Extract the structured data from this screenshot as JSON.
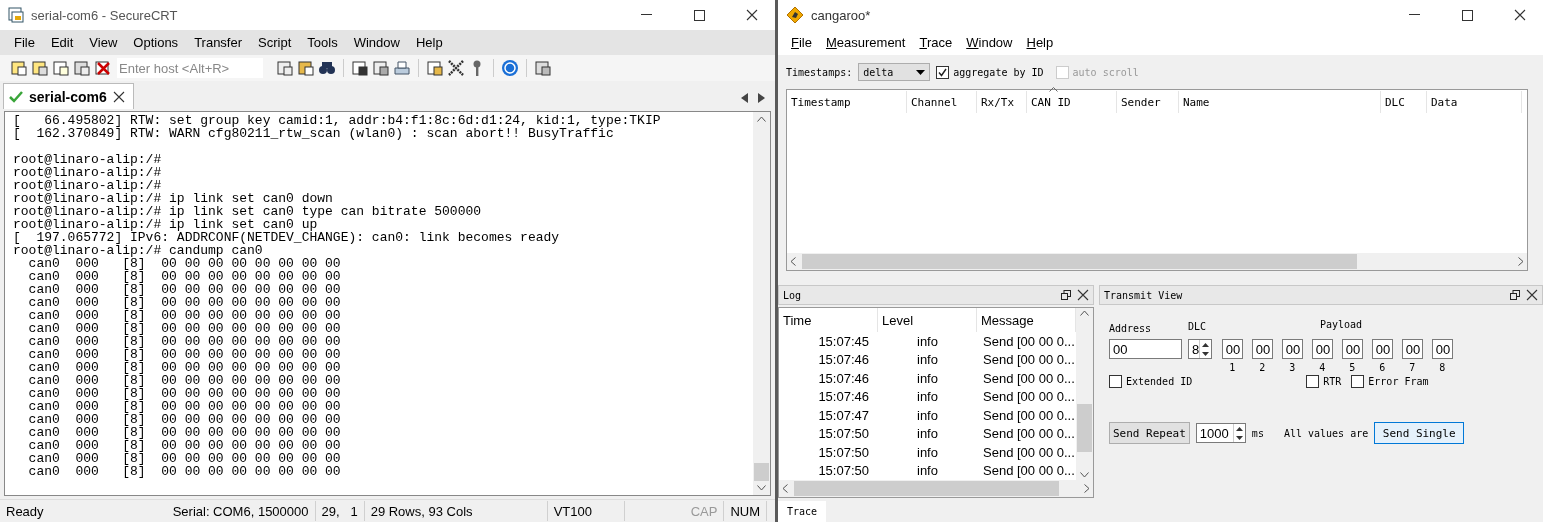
{
  "left_window": {
    "title": "serial-com6 - SecureCRT",
    "menu": [
      "File",
      "Edit",
      "View",
      "Options",
      "Transfer",
      "Script",
      "Tools",
      "Window",
      "Help"
    ],
    "host_field": {
      "placeholder": "Enter host <Alt+R>"
    },
    "tab": {
      "label": "serial-com6",
      "selected": true
    },
    "kernel_messages": [
      "[   66.495802] RTW: set group key camid:1, addr:b4:f1:8c:6d:d1:24, kid:1, type:TKIP",
      "[  162.370849] RTW: WARN cfg80211_rtw_scan (wlan0) : scan abort!! BusyTraffic"
    ],
    "terminal_lines": [
      "root@linaro-alip:/#",
      "root@linaro-alip:/#",
      "root@linaro-alip:/#",
      "root@linaro-alip:/# ip link set can0 down",
      "root@linaro-alip:/# ip link set can0 type can bitrate 500000",
      "root@linaro-alip:/# ip link set can0 up",
      "[  197.065772] IPv6: ADDRCONF(NETDEV_CHANGE): can0: link becomes ready",
      "root@linaro-alip:/# candump can0",
      "  can0  000   [8]  00 00 00 00 00 00 00 00",
      "  can0  000   [8]  00 00 00 00 00 00 00 00",
      "  can0  000   [8]  00 00 00 00 00 00 00 00",
      "  can0  000   [8]  00 00 00 00 00 00 00 00",
      "  can0  000   [8]  00 00 00 00 00 00 00 00",
      "  can0  000   [8]  00 00 00 00 00 00 00 00",
      "  can0  000   [8]  00 00 00 00 00 00 00 00",
      "  can0  000   [8]  00 00 00 00 00 00 00 00",
      "  can0  000   [8]  00 00 00 00 00 00 00 00",
      "  can0  000   [8]  00 00 00 00 00 00 00 00",
      "  can0  000   [8]  00 00 00 00 00 00 00 00",
      "  can0  000   [8]  00 00 00 00 00 00 00 00",
      "  can0  000   [8]  00 00 00 00 00 00 00 00",
      "  can0  000   [8]  00 00 00 00 00 00 00 00",
      "  can0  000   [8]  00 00 00 00 00 00 00 00",
      "  can0  000   [8]  00 00 00 00 00 00 00 00",
      "  can0  000   [8]  00 00 00 00 00 00 00 00"
    ],
    "status_bar": {
      "message": "Ready",
      "connection": "Serial: COM6, 1500000",
      "cursor": "29,   1",
      "size": "29 Rows, 93 Cols",
      "emulation": "VT100",
      "indicators": [
        {
          "label": "CAP",
          "on": false
        },
        {
          "label": "NUM",
          "on": true
        }
      ]
    }
  },
  "right_window": {
    "title": "cangaroo*",
    "menu": [
      "File",
      "Measurement",
      "Trace",
      "Window",
      "Help"
    ],
    "timestamps_label": "Timestamps:",
    "timestamps_select": "delta",
    "aggregate": {
      "label": "aggregate by ID",
      "checked": true,
      "disabled": false
    },
    "auto_scroll": {
      "label": "auto scroll",
      "checked": false,
      "disabled": true
    },
    "trace_columns": [
      "Timestamp",
      "Channel",
      "Rx/Tx",
      "CAN ID",
      "Sender",
      "Name",
      "DLC",
      "Data"
    ],
    "log_panel": {
      "title": "Log",
      "columns": [
        "Time",
        "Level",
        "Message"
      ],
      "rows": [
        {
          "time": "15:07:45",
          "level": "info",
          "message": "Send [00 00 0..."
        },
        {
          "time": "15:07:46",
          "level": "info",
          "message": "Send [00 00 0..."
        },
        {
          "time": "15:07:46",
          "level": "info",
          "message": "Send [00 00 0..."
        },
        {
          "time": "15:07:46",
          "level": "info",
          "message": "Send [00 00 0..."
        },
        {
          "time": "15:07:47",
          "level": "info",
          "message": "Send [00 00 0..."
        },
        {
          "time": "15:07:50",
          "level": "info",
          "message": "Send [00 00 0..."
        },
        {
          "time": "15:07:50",
          "level": "info",
          "message": "Send [00 00 0..."
        },
        {
          "time": "15:07:50",
          "level": "info",
          "message": "Send [00 00 0..."
        }
      ]
    },
    "transmit_panel": {
      "title": "Transmit View",
      "address_label": "Address",
      "dlc_label": "DLC",
      "payload_label": "Payload",
      "address": "00",
      "dlc": "8",
      "payload": [
        {
          "value": "00",
          "index": "1"
        },
        {
          "value": "00",
          "index": "2"
        },
        {
          "value": "00",
          "index": "3"
        },
        {
          "value": "00",
          "index": "4"
        },
        {
          "value": "00",
          "index": "5"
        },
        {
          "value": "00",
          "index": "6"
        },
        {
          "value": "00",
          "index": "7"
        },
        {
          "value": "00",
          "index": "8"
        }
      ],
      "options": [
        {
          "label": "Extended ID",
          "checked": false
        },
        {
          "label": "RTR",
          "checked": false
        },
        {
          "label": "Error Fram",
          "checked": false
        }
      ],
      "send_repeat": "Send Repeat",
      "interval": "1000",
      "interval_unit": "ms",
      "note": "All values are",
      "send_single": "Send Single"
    },
    "bottom_tabs": [
      {
        "label": "Trace",
        "selected": true
      }
    ]
  }
}
